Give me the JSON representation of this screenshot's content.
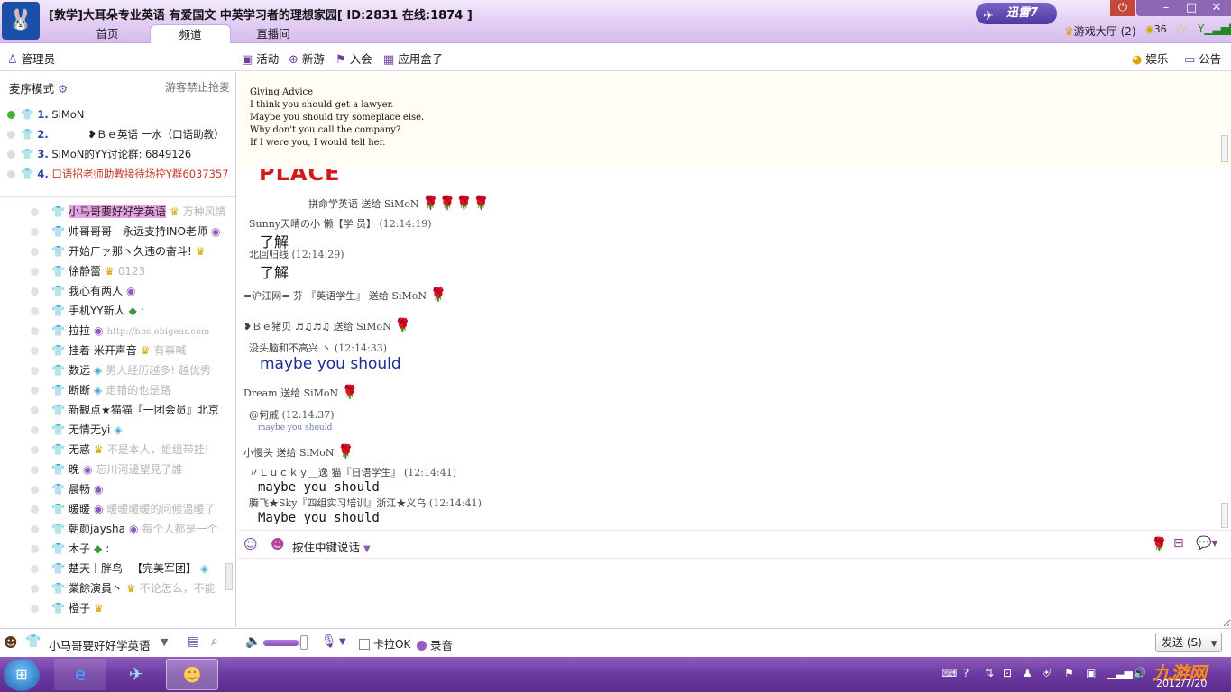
{
  "window": {
    "title": "[敦学]大耳朵专业英语 有爱国文 中英学习者的理想家园[ ID:2831 在线:1874 ]",
    "tabs": [
      "首页",
      "频道",
      "直播间"
    ],
    "xunlei_label": "迅雷7",
    "game_hall": "游戏大厅 (2)",
    "coin_count": "36"
  },
  "toolbar": {
    "admin": "管理员",
    "activity": "活动",
    "new_game": "新游",
    "join": "入会",
    "app_box": "应用盒子",
    "entertainment": "娱乐",
    "announcement": "公告"
  },
  "left": {
    "mic_mode": "麦序模式",
    "guest_ban": "游客禁止抢麦",
    "queue": [
      {
        "num": "1.",
        "name": "SiMoN"
      },
      {
        "num": "2.",
        "name": "❥Ｂｅ英语   一水（口语助教）"
      },
      {
        "num": "3.",
        "name": "SiMoN的YY讨论群: 6849126"
      },
      {
        "num": "4.",
        "name": "口语招老师助教接待场控Y群6037357"
      }
    ],
    "users": [
      {
        "name": "小马哥要好好学英语",
        "extra": "万种风情"
      },
      {
        "name": "帅哥哥哥",
        "extra": "永远支持INO老师"
      },
      {
        "name": "开始ㄏァ那ヽ久违の奋斗!",
        "extra": ""
      },
      {
        "name": "徐静蕾",
        "extra": "0123"
      },
      {
        "name": "我心有两人",
        "extra": ""
      },
      {
        "name": "手机YY新人",
        "extra": ":"
      },
      {
        "name": "拉拉",
        "extra": "http://bbs.ebigear.com"
      },
      {
        "name": "挂着 米开声音",
        "extra": "有事喊"
      },
      {
        "name": "数远",
        "extra": "男人经历越多! 越优秀"
      },
      {
        "name": "断断",
        "extra": "走错的也是路"
      },
      {
        "name": "新観点★猫猫『一团会员』北京",
        "extra": ""
      },
      {
        "name": "无情无yi",
        "extra": ""
      },
      {
        "name": "无惑",
        "extra": "不是本人，姐组带挂!"
      },
      {
        "name": "晚",
        "extra": "忘川河邊望見了誰"
      },
      {
        "name": "晨畅",
        "extra": ""
      },
      {
        "name": "暖暖",
        "extra": "暖暖暖暖的问候温暖了"
      },
      {
        "name": "朝颜jaysha",
        "extra": "每个人都是一个"
      },
      {
        "name": "木子",
        "extra": ":"
      },
      {
        "name": "楚天丨胖鸟",
        "extra": "【完美军团】"
      },
      {
        "name": "業餘演員丶",
        "extra": "不论怎么，不能"
      },
      {
        "name": "橙子",
        "extra": ""
      }
    ]
  },
  "broadcast": {
    "lines": [
      "Giving Advice",
      "I think you should get a lawyer.",
      "Maybe you should try someplace else.",
      "Why don't you call the company?",
      "If I were you, I would tell her."
    ]
  },
  "chat": {
    "place": "PLACE",
    "m1": "拼命学英语   送给 SiMoN",
    "m2_name": "Sunny天晴の小  懒【学    员】",
    "m2_time": "(12:14:19)",
    "m2_text": "了解",
    "m3_name": "北回归线",
    "m3_time": "(12:14:29)",
    "m3_text": "了解",
    "m4": "=沪江网= 芬    『英语学生』 送给 SiMoN",
    "m5": "❥Ｂｅ猪贝 ♬♫♬♫ 送给 SiMoN",
    "m6_name": "没头脑和不高兴  丶",
    "m6_time": "(12:14:33)",
    "m6_text": "maybe you should",
    "m7": "Dream 送给 SiMoN",
    "m8_name": "@何戚",
    "m8_time": "(12:14:37)",
    "m8_text": "maybe you should",
    "m9": "小慢头 送给 SiMoN",
    "m10_name": "〃Ｌｕｃｋｙ＿逸  猫『日语学生』",
    "m10_time": "(12:14:41)",
    "m10_text": "maybe you should",
    "m11_name": "腾飞★Sky『四组实习培训』浙江★义乌",
    "m11_time": "(12:14:41)",
    "m11_text": "Maybe you should"
  },
  "input": {
    "push_to_talk": "按住中键说话"
  },
  "bottom": {
    "self_name": "小马哥要好好学英语",
    "karaoke": "卡拉OK",
    "record": "录音",
    "send": "发送 (S)",
    "volume_level": 0.85
  },
  "taskbar": {
    "date": "2012/7/20",
    "watermark": "九游网"
  }
}
